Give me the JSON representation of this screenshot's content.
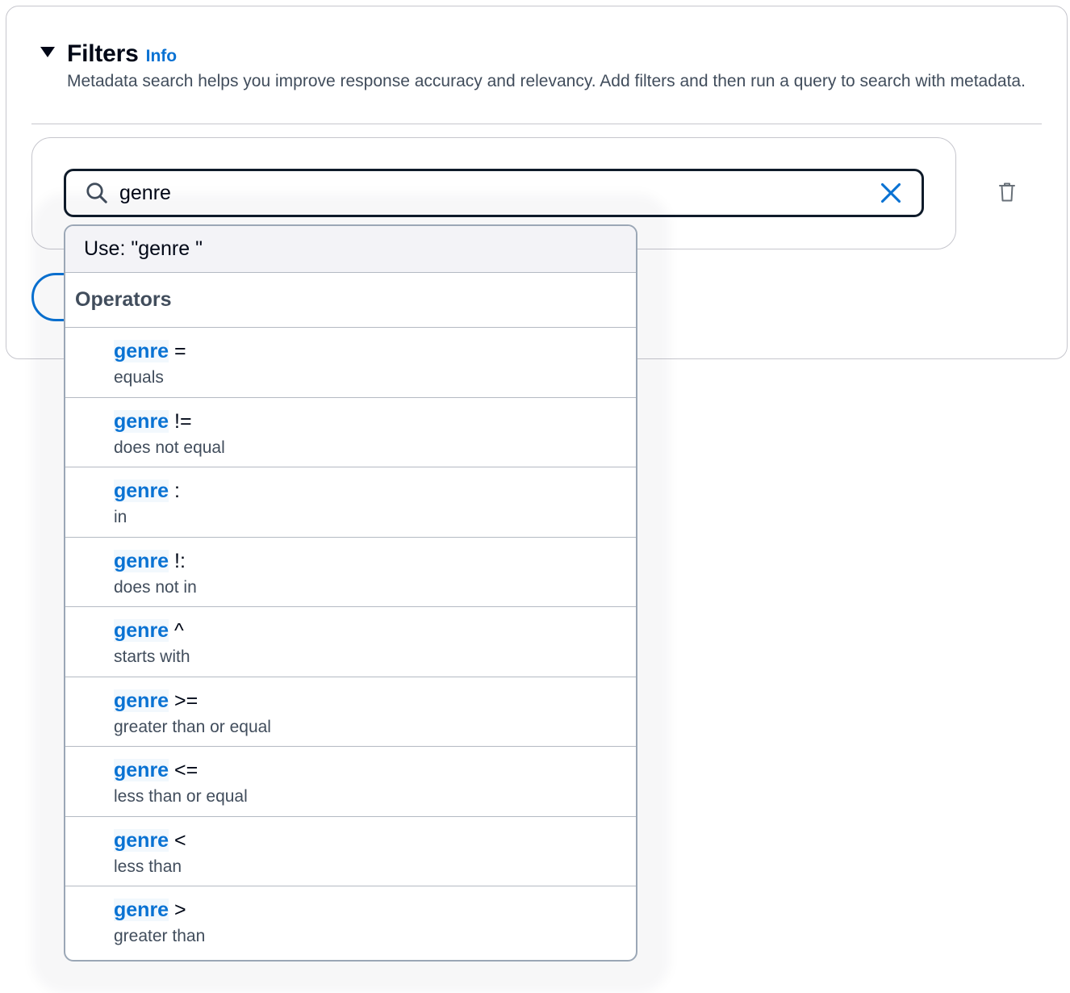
{
  "filters": {
    "title": "Filters",
    "info_label": "Info",
    "description": "Metadata search helps you improve response accuracy and relevancy. Add filters and then run a query to search with metadata."
  },
  "search": {
    "value": "genre"
  },
  "icons": {
    "search": "search-icon",
    "clear": "close-icon",
    "delete": "trash-icon",
    "expand": "caret-down-icon"
  },
  "dropdown": {
    "use_label": "Use: \"genre \"",
    "group_label": "Operators",
    "options": [
      {
        "key": "genre",
        "operator": " =",
        "description": "equals"
      },
      {
        "key": "genre",
        "operator": " !=",
        "description": "does not equal"
      },
      {
        "key": "genre",
        "operator": " :",
        "description": "in"
      },
      {
        "key": "genre",
        "operator": " !:",
        "description": "does not in"
      },
      {
        "key": "genre",
        "operator": " ^",
        "description": "starts with"
      },
      {
        "key": "genre",
        "operator": " >=",
        "description": "greater than or equal"
      },
      {
        "key": "genre",
        "operator": " <=",
        "description": "less than or equal"
      },
      {
        "key": "genre",
        "operator": " <",
        "description": "less than"
      },
      {
        "key": "genre",
        "operator": " >",
        "description": "greater than"
      }
    ]
  },
  "colors": {
    "accent": "#0972d3",
    "text": "#000716",
    "secondary_text": "#414d5c",
    "border": "#c6c6cd"
  }
}
